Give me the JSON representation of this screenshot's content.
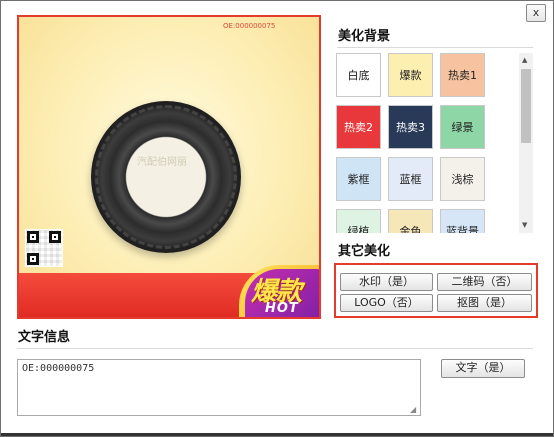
{
  "close_label": "x",
  "preview": {
    "oe_label": "OE:000000075",
    "watermark": "汽配伯网丽",
    "badge_text": "爆款",
    "badge_hot": "HOT"
  },
  "background_section": {
    "title": "美化背景",
    "tiles": [
      {
        "label": "白底",
        "bg": "#ffffff",
        "fg": "#222"
      },
      {
        "label": "爆款",
        "bg": "#fdefb0",
        "fg": "#222"
      },
      {
        "label": "热卖1",
        "bg": "#f6c2a0",
        "fg": "#222"
      },
      {
        "label": "热卖2",
        "bg": "#e8383b",
        "fg": "#fff"
      },
      {
        "label": "热卖3",
        "bg": "#283a58",
        "fg": "#fff"
      },
      {
        "label": "绿景",
        "bg": "#8fd6a6",
        "fg": "#222"
      },
      {
        "label": "紫框",
        "bg": "#cfe4f5",
        "fg": "#222"
      },
      {
        "label": "蓝框",
        "bg": "#e2ebf7",
        "fg": "#222"
      },
      {
        "label": "浅棕",
        "bg": "#f4f1ea",
        "fg": "#222"
      },
      {
        "label": "绿植",
        "bg": "#dff3e4",
        "fg": "#222"
      },
      {
        "label": "金色",
        "bg": "#f6e7b8",
        "fg": "#222"
      },
      {
        "label": "蓝背景",
        "bg": "#d7e6f6",
        "fg": "#222"
      }
    ]
  },
  "other_section": {
    "title": "其它美化",
    "watermark_btn": "水印（是）",
    "qrcode_btn": "二维码（否）",
    "logo_btn": "LOGO（否）",
    "cutout_btn": "抠图（是）"
  },
  "text_section": {
    "title": "文字信息",
    "text_value": "OE:000000075",
    "text_btn": "文字（是）"
  }
}
